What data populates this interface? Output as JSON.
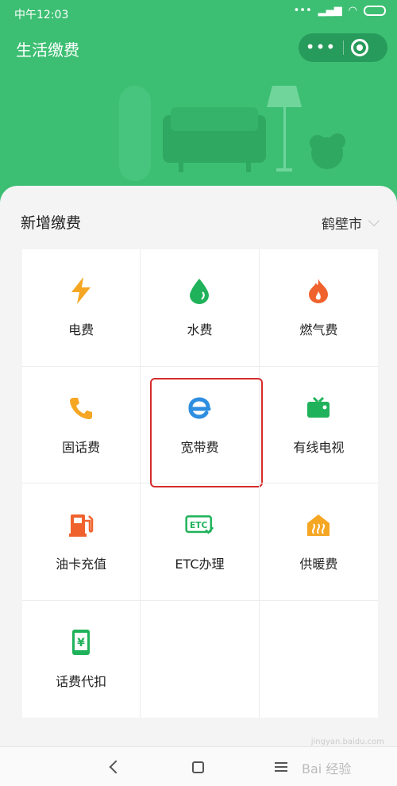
{
  "status_bar": {
    "time": "中午12:03",
    "dots": "•••"
  },
  "header": {
    "title": "生活缴费",
    "more_label": "•••"
  },
  "section": {
    "title": "新增缴费",
    "city": "鹤壁市"
  },
  "services": [
    {
      "label": "电费",
      "icon": "lightning-icon",
      "color": "#f5a623"
    },
    {
      "label": "水费",
      "icon": "water-drop-icon",
      "color": "#1fb25a"
    },
    {
      "label": "燃气费",
      "icon": "flame-icon",
      "color": "#f0622d"
    },
    {
      "label": "固话费",
      "icon": "phone-icon",
      "color": "#f5a623"
    },
    {
      "label": "宽带费",
      "icon": "broadband-e-icon",
      "color": "#2e8ee0"
    },
    {
      "label": "有线电视",
      "icon": "tv-icon",
      "color": "#1fb25a"
    },
    {
      "label": "油卡充值",
      "icon": "gas-pump-icon",
      "color": "#f0622d"
    },
    {
      "label": "ETC办理",
      "icon": "etc-icon",
      "color": "#1fb25a"
    },
    {
      "label": "供暖费",
      "icon": "heating-icon",
      "color": "#f5a623"
    },
    {
      "label": "话费代扣",
      "icon": "mobile-yuan-icon",
      "color": "#1fb25a"
    }
  ],
  "watermark": {
    "text": "Bai 经验",
    "url": "jingyan.baidu.com"
  }
}
